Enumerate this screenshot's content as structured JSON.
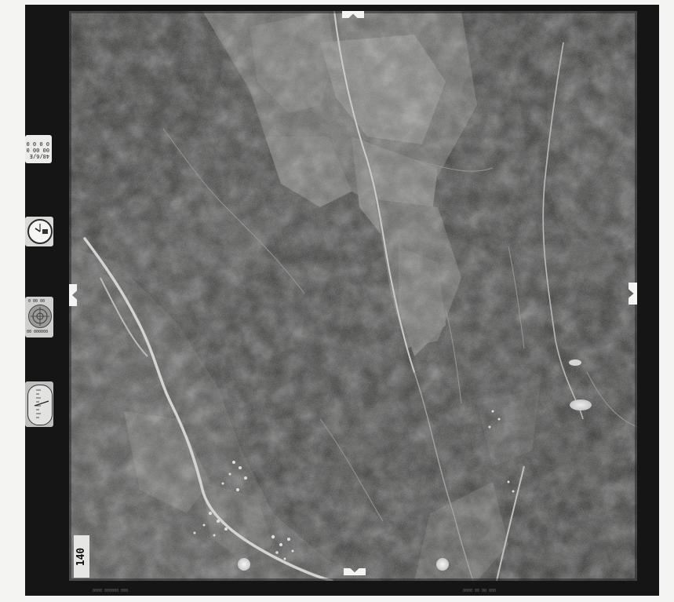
{
  "photo": {
    "subject": "",
    "frame_number": "140"
  },
  "instruments": {
    "label_card": "48/6/E\n00 00 0\n0 0 0 0",
    "clock_icon": "clock-icon",
    "altimeter_text_top": "0 00 00",
    "altimeter_text_bottom": "00 000000",
    "level_icon": "level-bubble-icon",
    "counter_icon": "counter-dial-icon"
  },
  "bottom_edge": {
    "left_text": "0000  000000 000",
    "right_text": "0000 00 00 000"
  },
  "colors": {
    "film_border": "#151515",
    "background": "#f4f4f2",
    "fiducial": "#f4f4f2"
  }
}
